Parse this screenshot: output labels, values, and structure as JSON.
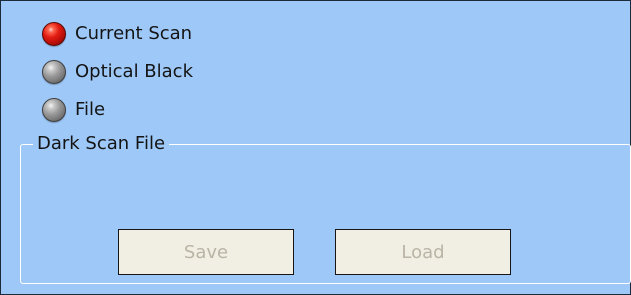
{
  "scan_source": {
    "options": [
      {
        "label": "Current Scan",
        "selected": true
      },
      {
        "label": "Optical Black",
        "selected": false
      },
      {
        "label": "File",
        "selected": false
      }
    ]
  },
  "dark_scan_file": {
    "title": "Dark Scan File",
    "save_label": "Save",
    "load_label": "Load",
    "buttons_enabled": false
  },
  "colors": {
    "panel_background": "#9ec8f8",
    "selected_led": "#e21c12",
    "unselected_led": "#9a9a9a",
    "disabled_button_text": "#b9b4a5"
  },
  "icons": {
    "selected": "red-led-icon",
    "unselected": "gray-led-icon"
  }
}
